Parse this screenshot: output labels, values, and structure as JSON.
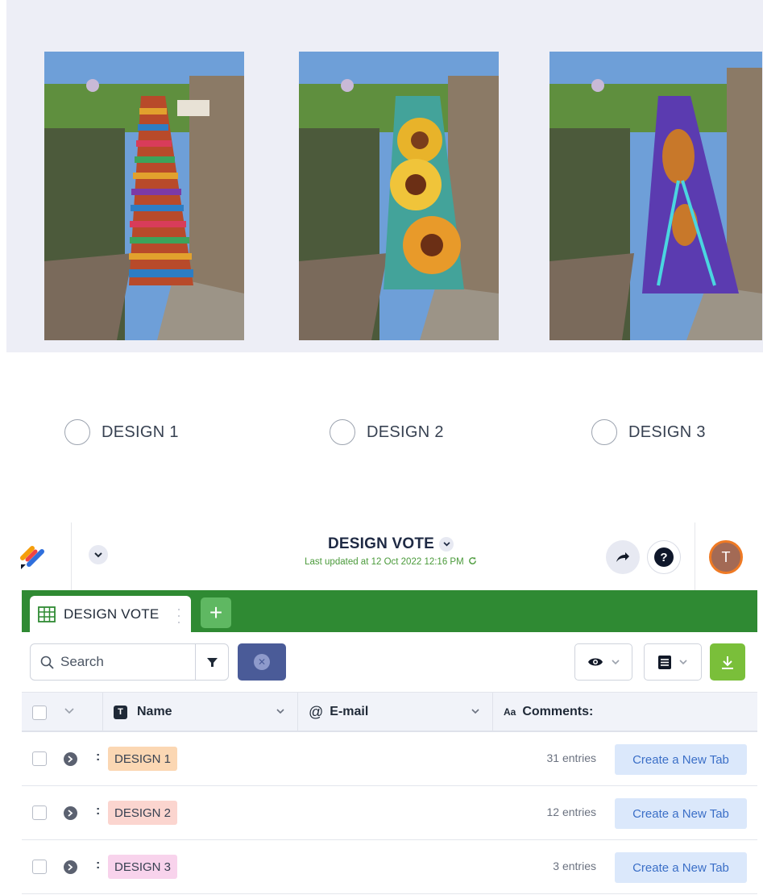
{
  "designs": {
    "option_1": "DESIGN 1",
    "option_2": "DESIGN 2",
    "option_3": "DESIGN 3"
  },
  "header": {
    "title": "DESIGN VOTE",
    "last_updated": "Last updated at 12 Oct 2022 12:16 PM",
    "avatar_initial": "T"
  },
  "tabs": {
    "active_label": "DESIGN VOTE",
    "add_label": "+"
  },
  "toolbar": {
    "search_placeholder": "Search"
  },
  "table": {
    "columns": {
      "name": "Name",
      "email": "E-mail",
      "comments": "Comments:",
      "name_badge": "T",
      "email_badge": "@",
      "comments_badge": "Aa"
    },
    "rows": [
      {
        "label": "DESIGN 1",
        "entries": "31 entries",
        "action": "Create a New Tab",
        "color": "#fbd7b3"
      },
      {
        "label": "DESIGN 2",
        "entries": "12 entries",
        "action": "Create a New Tab",
        "color": "#fbd5cf"
      },
      {
        "label": "DESIGN 3",
        "entries": "3 entries",
        "action": "Create a New Tab",
        "color": "#f8d3ec"
      }
    ]
  },
  "colors": {
    "tabbar": "#2f8a33",
    "accent_blue": "#4a5b98",
    "download": "#7abf3a",
    "updated_text": "#4a9a3a"
  },
  "icons": [
    "brand-logo-icon",
    "chevron-down-icon",
    "share-arrow-icon",
    "help-icon",
    "table-grid-icon",
    "search-icon",
    "filter-icon",
    "close-icon",
    "eye-icon",
    "list-icon",
    "download-icon",
    "chevron-right-icon",
    "refresh-icon"
  ]
}
